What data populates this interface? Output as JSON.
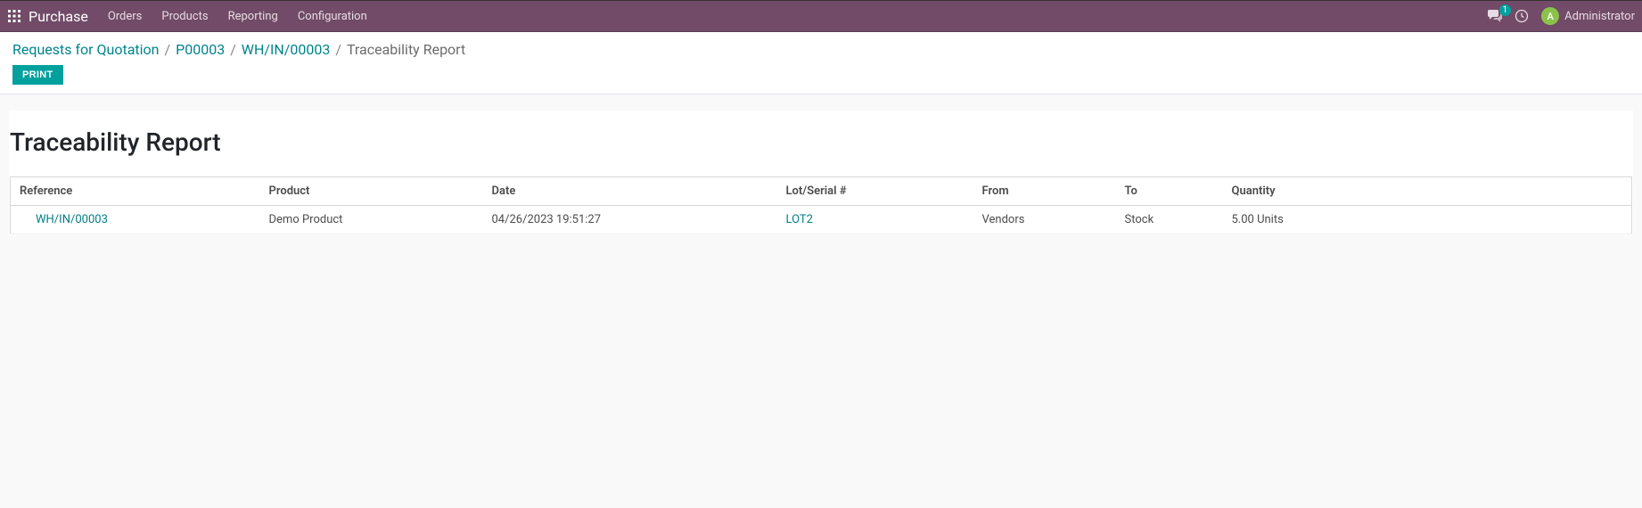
{
  "nav": {
    "app_title": "Purchase",
    "menu": [
      "Orders",
      "Products",
      "Reporting",
      "Configuration"
    ],
    "messages_badge": "1",
    "user_initial": "A",
    "user_name": "Administrator"
  },
  "breadcrumb": {
    "items": [
      {
        "label": "Requests for Quotation",
        "link": true
      },
      {
        "label": "P00003",
        "link": true
      },
      {
        "label": "WH/IN/00003",
        "link": true
      },
      {
        "label": "Traceability Report",
        "link": false
      }
    ]
  },
  "buttons": {
    "print": "PRINT"
  },
  "page": {
    "title": "Traceability Report"
  },
  "table": {
    "headers": {
      "reference": "Reference",
      "product": "Product",
      "date": "Date",
      "lot": "Lot/Serial #",
      "from": "From",
      "to": "To",
      "quantity": "Quantity"
    },
    "rows": [
      {
        "reference": "WH/IN/00003",
        "product": "Demo Product",
        "date": "04/26/2023 19:51:27",
        "lot": "LOT2",
        "from": "Vendors",
        "to": "Stock",
        "quantity": "5.00 Units"
      }
    ]
  }
}
